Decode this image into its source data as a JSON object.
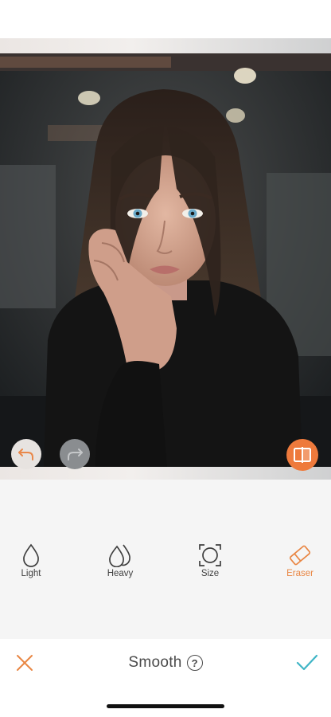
{
  "editor": {
    "title": "Smooth",
    "help_glyph": "?",
    "tools": [
      {
        "label": "Light",
        "icon": "drop-light-icon"
      },
      {
        "label": "Heavy",
        "icon": "drop-heavy-icon"
      },
      {
        "label": "Size",
        "icon": "brush-size-icon"
      },
      {
        "label": "Eraser",
        "icon": "eraser-icon"
      }
    ],
    "active_tool": "Eraser"
  },
  "icons": {
    "undo": "undo-icon",
    "redo": "redo-icon",
    "compare": "compare-icon",
    "cancel": "close-icon",
    "confirm": "checkmark-icon",
    "help": "help-icon"
  },
  "colors": {
    "accent": "#ee7a3c",
    "confirm": "#3fb5c6",
    "text": "#3f3f3f"
  }
}
